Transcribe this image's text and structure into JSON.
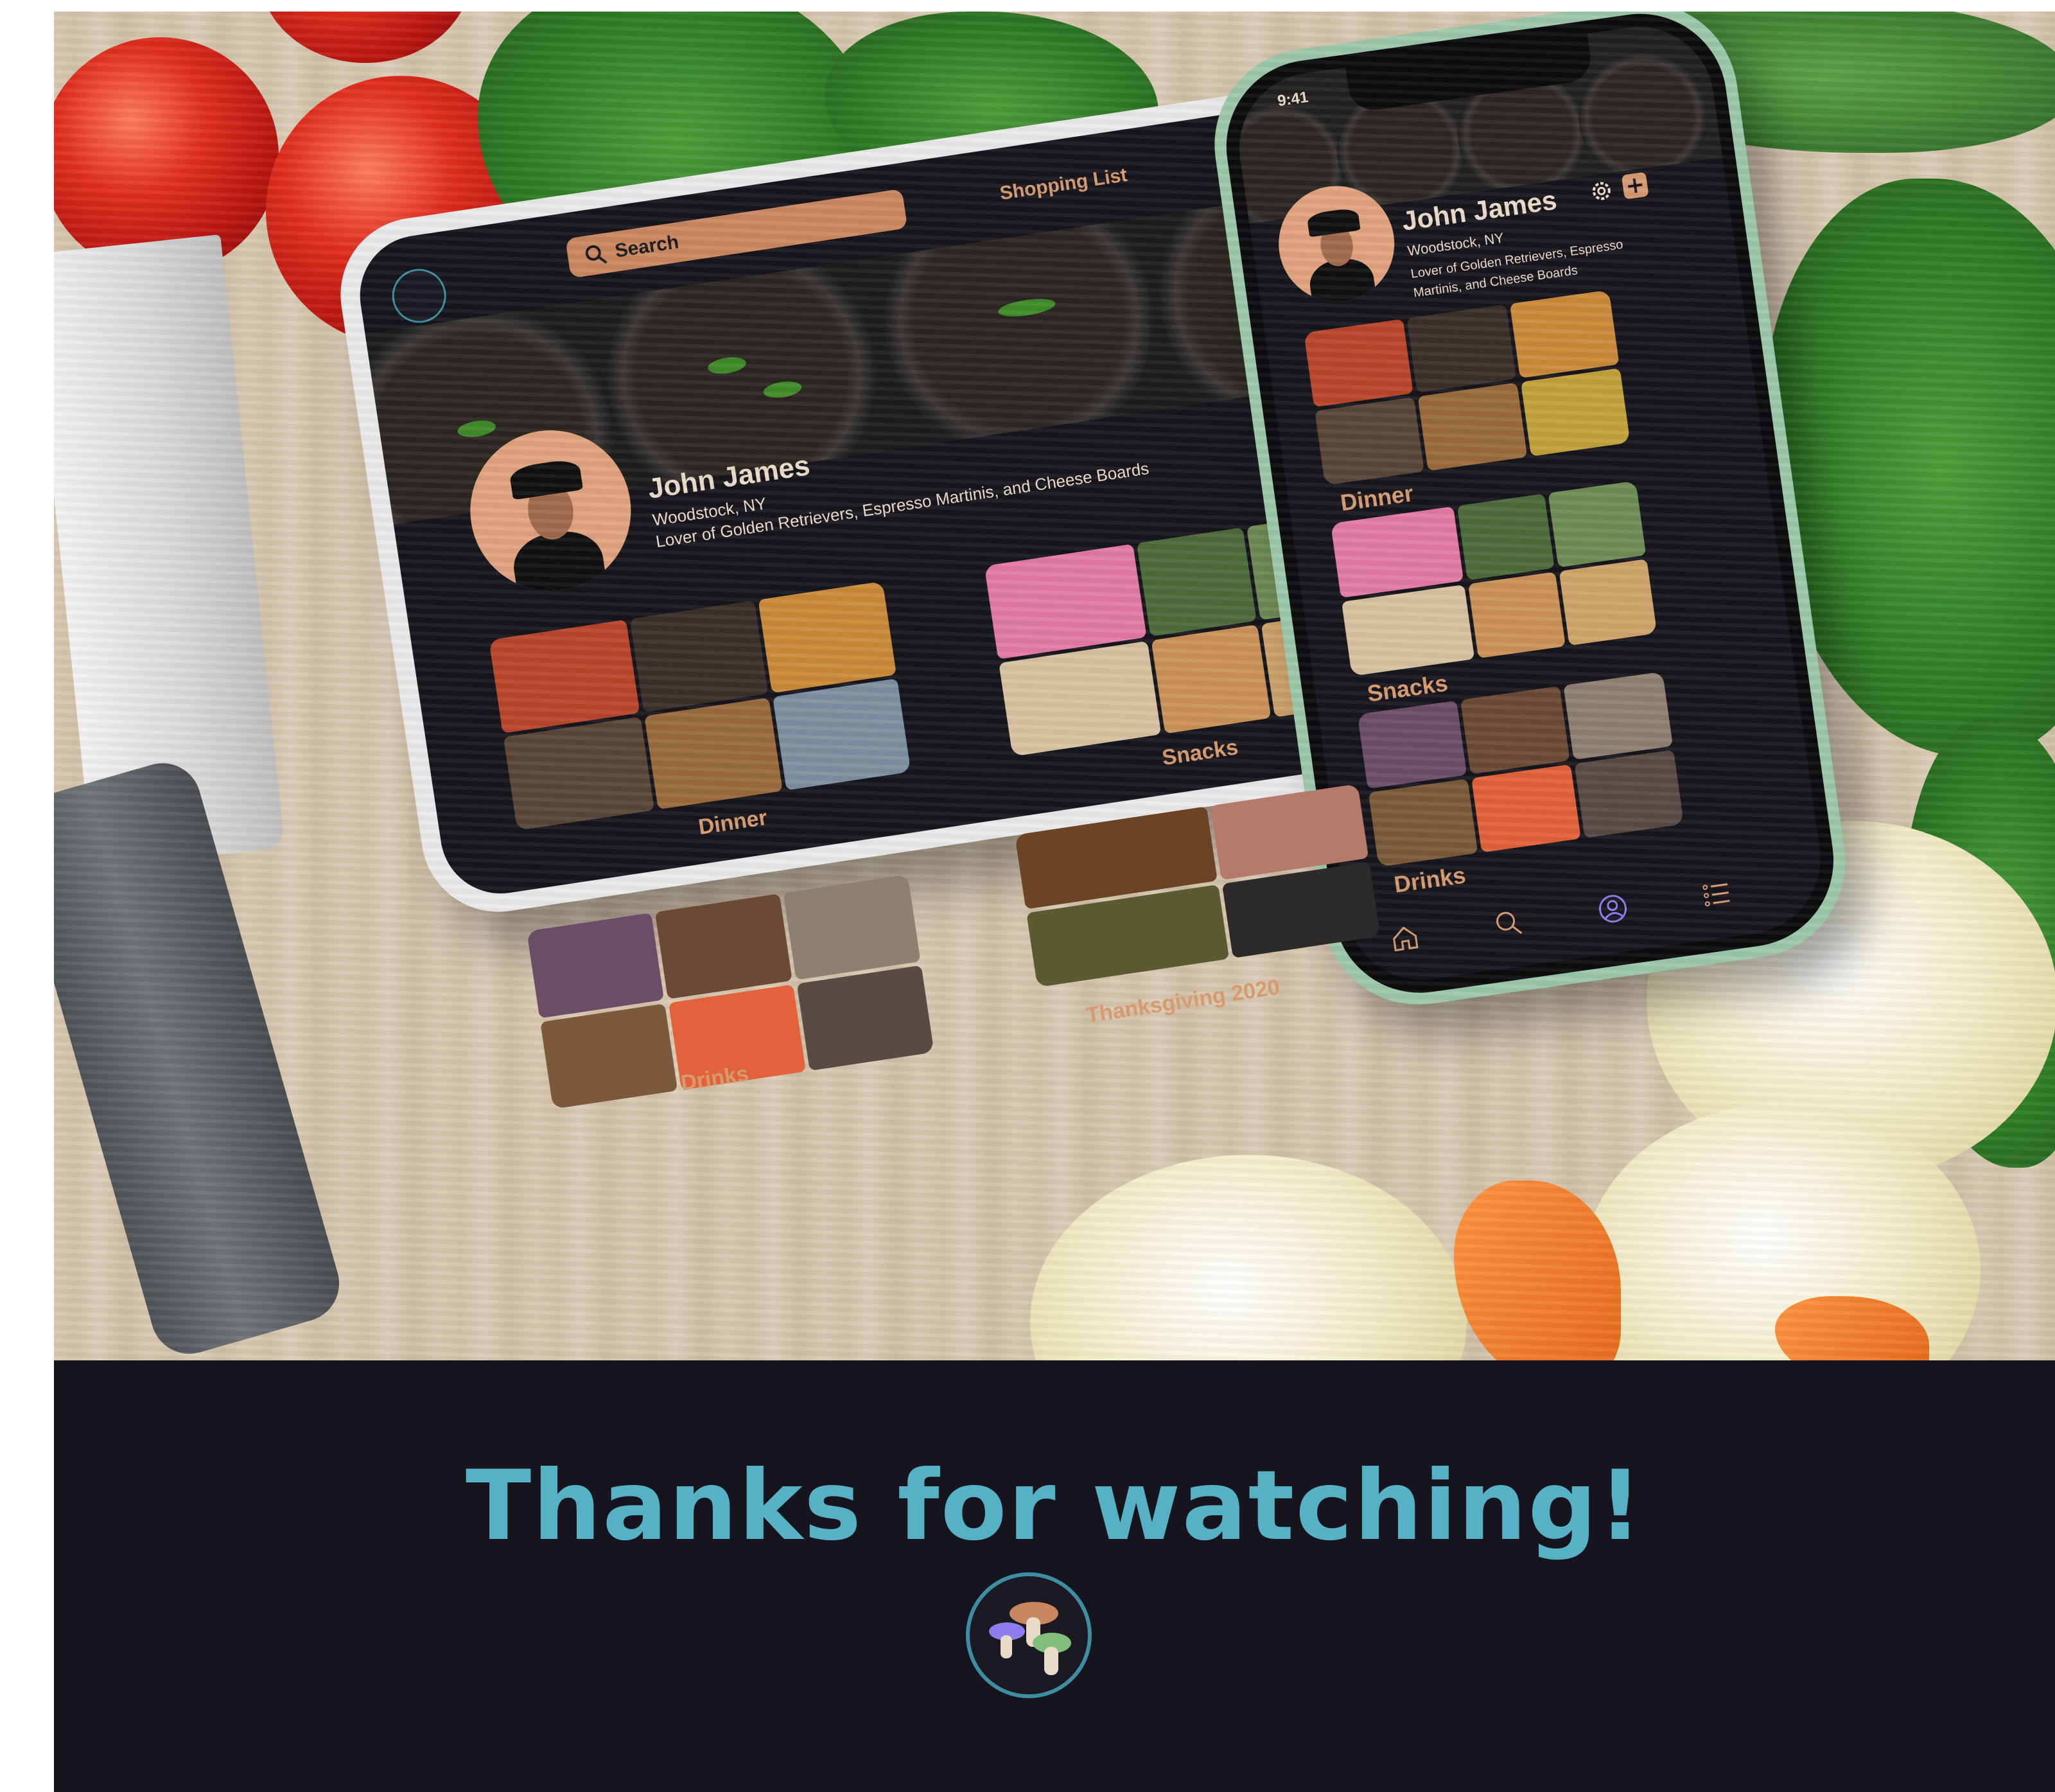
{
  "tablet": {
    "search_placeholder": "Search",
    "shopping_list_label": "Shopping List",
    "profile": {
      "name": "John James",
      "location": "Woodstock, NY",
      "bio": "Lover of Golden Retrievers, Espresso Martinis, and Cheese Boards"
    },
    "collections": [
      "Dinner",
      "Snacks",
      "Drinks",
      "Thanksgiving 2020"
    ]
  },
  "phone": {
    "status_time": "9:41",
    "profile": {
      "name": "John James",
      "location": "Woodstock, NY",
      "bio": "Lover of Golden Retrievers, Espresso Martinis, and Cheese Boards"
    },
    "collections": [
      "Dinner",
      "Snacks",
      "Drinks"
    ],
    "tab_bar": [
      "home-icon",
      "search-icon",
      "profile-icon",
      "list-icon"
    ]
  },
  "footer": {
    "message": "Thanks for watching!"
  },
  "colors": {
    "accent_copper": "#d69a6f",
    "app_background": "#17161d",
    "footer_text": "#56b0c6",
    "active_tab": "#8f7df0"
  }
}
